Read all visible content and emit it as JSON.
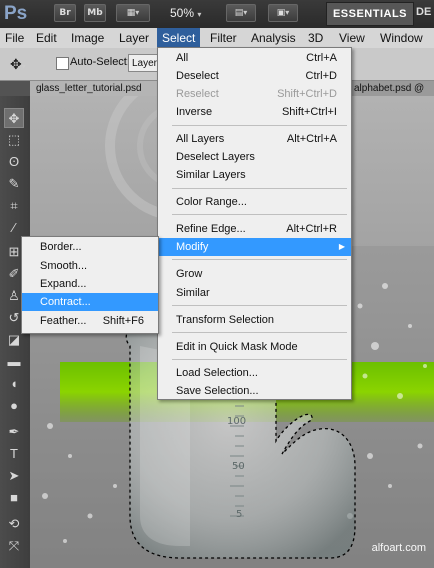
{
  "app": {
    "logo": "Ps",
    "btn_br": "Br",
    "btn_mb": "Mb",
    "zoom": "50%",
    "workspace": "ESSENTIALS",
    "workspace_next": "DE"
  },
  "menubar": [
    "File",
    "Edit",
    "Image",
    "Layer",
    "Select",
    "Filter",
    "Analysis",
    "3D",
    "View",
    "Window"
  ],
  "options": {
    "auto_select_label": "Auto-Select:",
    "auto_select_value": "Layer"
  },
  "tabs": {
    "active": "glass_letter_tutorial.psd",
    "other": "alphabet.psd @"
  },
  "select_menu": {
    "items": [
      {
        "label": "All",
        "shortcut": "Ctrl+A"
      },
      {
        "label": "Deselect",
        "shortcut": "Ctrl+D"
      },
      {
        "label": "Reselect",
        "shortcut": "Shift+Ctrl+D",
        "disabled": true
      },
      {
        "label": "Inverse",
        "shortcut": "Shift+Ctrl+I"
      },
      {
        "label": "All Layers",
        "shortcut": "Alt+Ctrl+A"
      },
      {
        "label": "Deselect Layers",
        "shortcut": ""
      },
      {
        "label": "Similar Layers",
        "shortcut": ""
      },
      {
        "label": "Color Range...",
        "shortcut": ""
      },
      {
        "label": "Refine Edge...",
        "shortcut": "Alt+Ctrl+R"
      },
      {
        "label": "Modify",
        "shortcut": "",
        "highlighted": true
      },
      {
        "label": "Grow",
        "shortcut": ""
      },
      {
        "label": "Similar",
        "shortcut": ""
      },
      {
        "label": "Transform Selection",
        "shortcut": ""
      },
      {
        "label": "Edit in Quick Mask Mode",
        "shortcut": ""
      },
      {
        "label": "Load Selection...",
        "shortcut": ""
      },
      {
        "label": "Save Selection...",
        "shortcut": ""
      }
    ]
  },
  "modify_menu": {
    "items": [
      {
        "label": "Border...",
        "shortcut": ""
      },
      {
        "label": "Smooth...",
        "shortcut": ""
      },
      {
        "label": "Expand...",
        "shortcut": ""
      },
      {
        "label": "Contract...",
        "shortcut": "",
        "highlighted": true
      },
      {
        "label": "Feather...",
        "shortcut": "Shift+F6"
      }
    ]
  },
  "canvas": {
    "scale_marks": [
      "100",
      "50",
      "5"
    ],
    "watermark": "alfoart.com"
  },
  "colors": {
    "accent": "#3399ff",
    "menubar_active": "#2f5f9c",
    "green": "#8bd400"
  }
}
